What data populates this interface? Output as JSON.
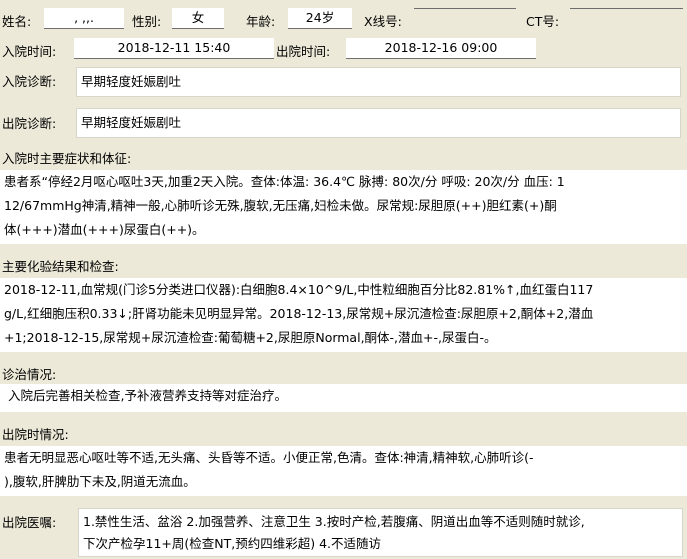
{
  "patient": {
    "name_label": "姓名:",
    "name_value": ", ,,.",
    "gender_label": "性别:",
    "gender_value": "女",
    "age_label": "年龄:",
    "age_value": "24岁",
    "xray_label": "X线号:",
    "xray_value": "",
    "ct_label": "CT号:",
    "ct_value": ""
  },
  "admission": {
    "in_label": "入院时间:",
    "in_value": "2018-12-11 15:40",
    "out_label": "出院时间:",
    "out_value": "2018-12-16 09:00"
  },
  "diagnosis": {
    "in_label": "入院诊断:",
    "in_value": "早期轻度妊娠剧吐",
    "out_label": "出院诊断:",
    "out_value": "早期轻度妊娠剧吐"
  },
  "symptoms": {
    "label": "入院时主要症状和体征:",
    "lines": [
      "患者系“停经2月呕心呕吐3天,加重2天入院。查体:体温: 36.4℃  脉搏: 80次/分  呼吸: 20次/分  血压: 1",
      "12/67mmHg神清,精神一般,心肺听诊无殊,腹软,无压痛,妇检未做。尿常规:尿胆原(++)胆红素(+)酮",
      "体(+++)潜血(+++)尿蛋白(++)。"
    ]
  },
  "lab": {
    "label": "主要化验结果和检查:",
    "lines": [
      " 2018-12-11,血常规(门诊5分类进口仪器):白细胞8.4×10^9/L,中性粒细胞百分比82.81%↑,血红蛋白117",
      "g/L,红细胞压积0.33↓;肝肾功能未见明显异常。2018-12-13,尿常规+尿沉渣检查:尿胆原+2,酮体+2,潜血",
      "+1;2018-12-15,尿常规+尿沉渣检查:葡萄糖+2,尿胆原Normal,酮体-,潜血+-,尿蛋白-。"
    ]
  },
  "treatment": {
    "label": "诊治情况:",
    "lines": [
      "入院后完善相关检查,予补液营养支持等对症治疗。"
    ]
  },
  "discharge_status": {
    "label": "出院时情况:",
    "lines": [
      " 患者无明显恶心呕吐等不适,无头痛、头昏等不适。小便正常,色清。查体:神清,精神软,心肺听诊(-",
      "),腹软,肝脾肋下未及,阴道无流血。"
    ]
  },
  "orders": {
    "label": "出院医嘱:",
    "lines": [
      " 1.禁性生活、盆浴 2.加强营养、注意卫生 3.按时产检,若腹痛、阴道出血等不适则随时就诊,",
      "下次产检孕11+周(检查NT,预约四维彩超) 4.不适随访"
    ]
  }
}
